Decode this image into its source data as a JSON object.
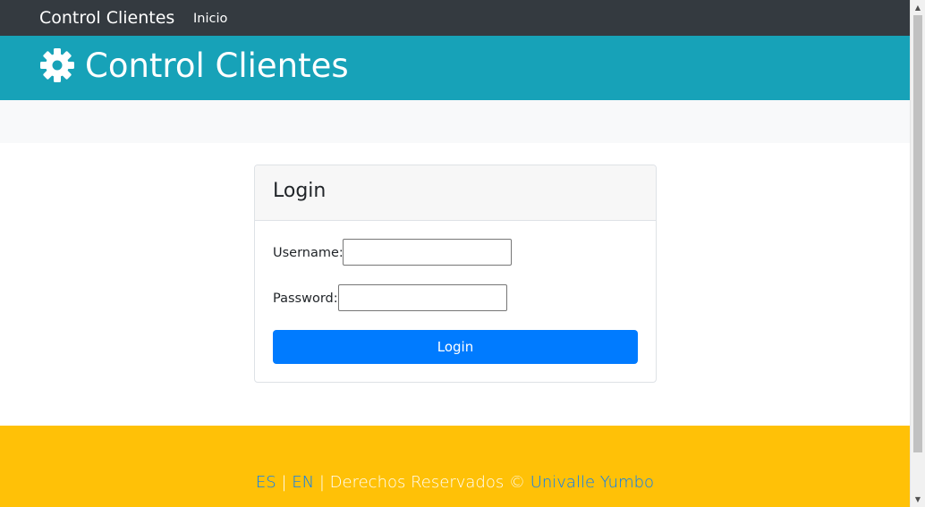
{
  "navbar": {
    "brand": "Control Clientes",
    "links": [
      "Inicio"
    ]
  },
  "header": {
    "icon": "gear-icon",
    "title": "Control Clientes"
  },
  "login_card": {
    "title": "Login",
    "username_label": "Username:",
    "username_value": "",
    "password_label": "Password:",
    "password_value": "",
    "submit_label": "Login"
  },
  "footer": {
    "lang_es": "ES",
    "sep1": "|",
    "lang_en": "EN",
    "sep2": "|",
    "rights": "Derechos Reservados ©",
    "org": "Univalle Yumbo"
  },
  "colors": {
    "navbar": "#343a40",
    "header": "#17a2b8",
    "primary": "#007bff",
    "footer": "#ffc107"
  }
}
